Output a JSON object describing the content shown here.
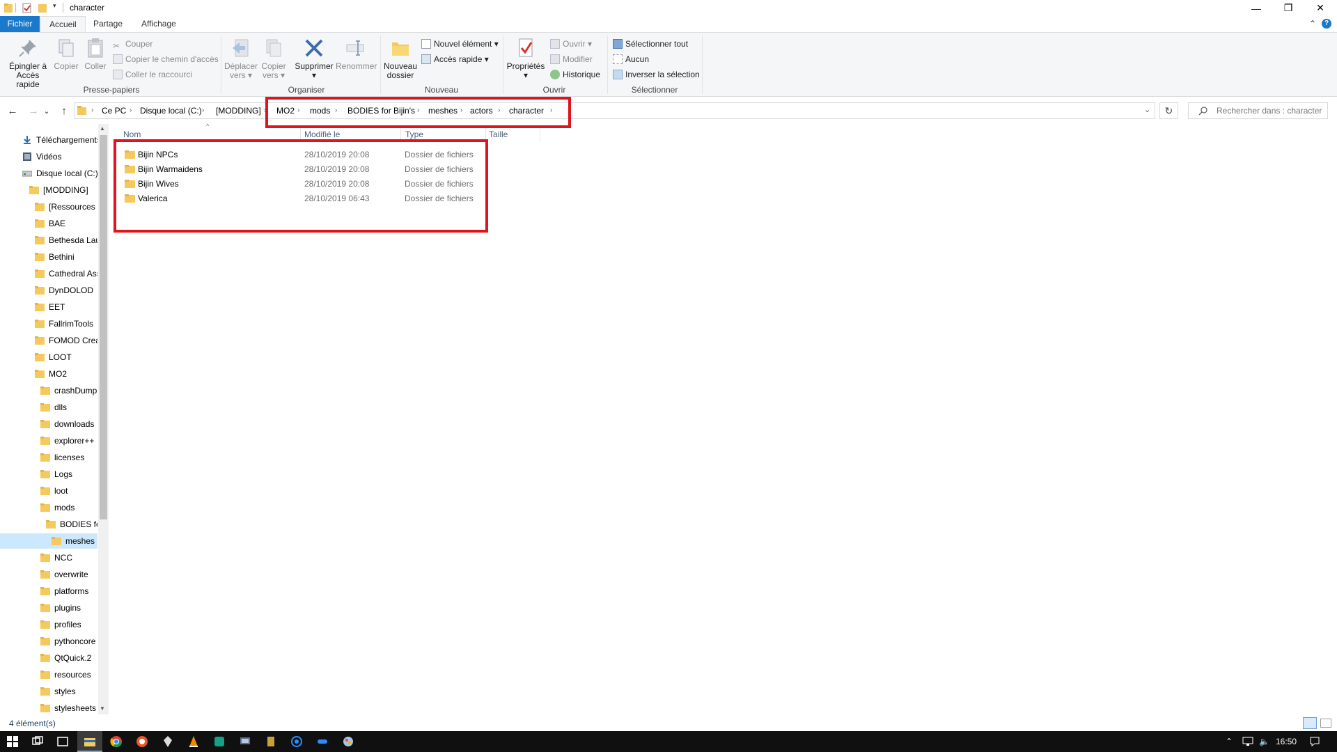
{
  "window": {
    "title": "character",
    "minimize_glyph": "—",
    "maximize_glyph": "❐",
    "close_glyph": "✕",
    "collapse_glyph": "⌃",
    "help_glyph": "?"
  },
  "tabs": [
    {
      "label": "Fichier"
    },
    {
      "label": "Accueil"
    },
    {
      "label": "Partage"
    },
    {
      "label": "Affichage"
    }
  ],
  "ribbon": {
    "pin": {
      "line1": "Épingler à",
      "line2": "Accès rapide"
    },
    "copy": "Copier",
    "paste": "Coller",
    "cut": "Couper",
    "copy_path": "Copier le chemin d'accès",
    "paste_shortcut": "Coller le raccourci",
    "clipboard_group": "Presse-papiers",
    "move_to": {
      "line1": "Déplacer",
      "line2": "vers"
    },
    "copy_to": {
      "line1": "Copier",
      "line2": "vers"
    },
    "delete": "Supprimer",
    "rename": "Renommer",
    "organize_group": "Organiser",
    "new_folder": {
      "line1": "Nouveau",
      "line2": "dossier"
    },
    "new_item": "Nouvel élément",
    "easy_access": "Accès rapide",
    "new_group": "Nouveau",
    "properties": "Propriétés",
    "open": "Ouvrir",
    "edit": "Modifier",
    "history": "Historique",
    "open_group": "Ouvrir",
    "select_all": "Sélectionner tout",
    "select_none": "Aucun",
    "invert_selection": "Inverser la sélection",
    "select_group": "Sélectionner"
  },
  "nav": {
    "back_glyph": "←",
    "forward_glyph": "→",
    "recent_glyph": "⌄",
    "up_glyph": "↑",
    "breadcrumb": [
      "Ce PC",
      "Disque local (C:)",
      "[MODDING]",
      "MO2",
      "mods",
      "BODIES for Bijin's",
      "meshes",
      "actors",
      "character"
    ],
    "chevron_glyph": "›",
    "dropdown_glyph": "⌄",
    "refresh_glyph": "↻",
    "search_placeholder": "Rechercher dans : character"
  },
  "tree": [
    {
      "label": "Téléchargements",
      "icon": "download-icon"
    },
    {
      "label": "Vidéos",
      "icon": "video-icon"
    },
    {
      "label": "Disque local (C:)",
      "icon": "drive-icon"
    },
    {
      "label": "[MODDING]",
      "icon": "folder-icon"
    },
    {
      "label": "[Ressources p",
      "icon": "folder-icon"
    },
    {
      "label": "BAE",
      "icon": "folder-icon"
    },
    {
      "label": "Bethesda Lau",
      "icon": "folder-icon"
    },
    {
      "label": "Bethini",
      "icon": "folder-icon"
    },
    {
      "label": "Cathedral Ass",
      "icon": "folder-icon"
    },
    {
      "label": "DynDOLOD",
      "icon": "folder-icon"
    },
    {
      "label": "EET",
      "icon": "folder-icon"
    },
    {
      "label": "FallrimTools",
      "icon": "folder-icon"
    },
    {
      "label": "FOMOD Crea",
      "icon": "folder-icon"
    },
    {
      "label": "LOOT",
      "icon": "folder-icon"
    },
    {
      "label": "MO2",
      "icon": "folder-icon"
    },
    {
      "label": "crashDump",
      "icon": "folder-icon"
    },
    {
      "label": "dlls",
      "icon": "folder-icon"
    },
    {
      "label": "downloads",
      "icon": "folder-icon"
    },
    {
      "label": "explorer++",
      "icon": "folder-icon"
    },
    {
      "label": "licenses",
      "icon": "folder-icon"
    },
    {
      "label": "Logs",
      "icon": "folder-icon"
    },
    {
      "label": "loot",
      "icon": "folder-icon"
    },
    {
      "label": "mods",
      "icon": "folder-icon"
    },
    {
      "label": "BODIES fo",
      "icon": "folder-icon"
    },
    {
      "label": "meshes",
      "icon": "folder-icon"
    },
    {
      "label": "NCC",
      "icon": "folder-icon"
    },
    {
      "label": "overwrite",
      "icon": "folder-icon"
    },
    {
      "label": "platforms",
      "icon": "folder-icon"
    },
    {
      "label": "plugins",
      "icon": "folder-icon"
    },
    {
      "label": "profiles",
      "icon": "folder-icon"
    },
    {
      "label": "pythoncore",
      "icon": "folder-icon"
    },
    {
      "label": "QtQuick.2",
      "icon": "folder-icon"
    },
    {
      "label": "resources",
      "icon": "folder-icon"
    },
    {
      "label": "styles",
      "icon": "folder-icon"
    },
    {
      "label": "stylesheets",
      "icon": "folder-icon"
    }
  ],
  "list": {
    "columns": {
      "name": "Nom",
      "modified": "Modifié le",
      "type": "Type",
      "size": "Taille"
    },
    "sort_glyph": "^",
    "rows": [
      {
        "name": "Bijin NPCs",
        "modified": "28/10/2019 20:08",
        "type": "Dossier de fichiers"
      },
      {
        "name": "Bijin Warmaidens",
        "modified": "28/10/2019 20:08",
        "type": "Dossier de fichiers"
      },
      {
        "name": "Bijin Wives",
        "modified": "28/10/2019 20:08",
        "type": "Dossier de fichiers"
      },
      {
        "name": "Valerica",
        "modified": "28/10/2019 06:43",
        "type": "Dossier de fichiers"
      }
    ]
  },
  "status": {
    "count": "4 élément(s)"
  },
  "taskbar": {
    "time": "16:50"
  },
  "colors": {
    "accent": "#1979ca",
    "highlight": "#e0141e",
    "selection": "#cce8ff",
    "folder": "#f4c95d"
  }
}
